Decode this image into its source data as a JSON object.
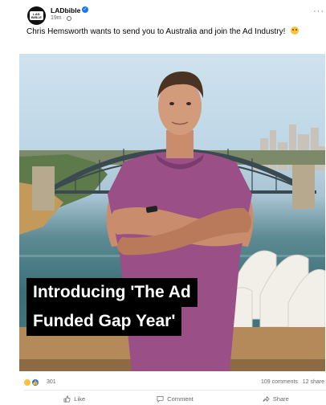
{
  "post": {
    "page_name": "LADbible",
    "avatar_text_top": "LAD",
    "avatar_text_bottom": "BIBLE",
    "time": "19m ·",
    "more": "···",
    "caption": "Chris Hemsworth wants to send you to Australia and join the Ad Industry!"
  },
  "image": {
    "headline_line1": "Introducing 'The Ad",
    "headline_line2": "Funded Gap Year'"
  },
  "reactions": {
    "count": "301",
    "comments": "109 comments",
    "shares": "12 share"
  },
  "actions": {
    "like": "Like",
    "comment": "Comment",
    "share": "Share"
  },
  "colors": {
    "accent": "#1877f2",
    "shirt": "#9a4f86",
    "sky": "#cfe2ee",
    "water": "#3a6f78"
  }
}
